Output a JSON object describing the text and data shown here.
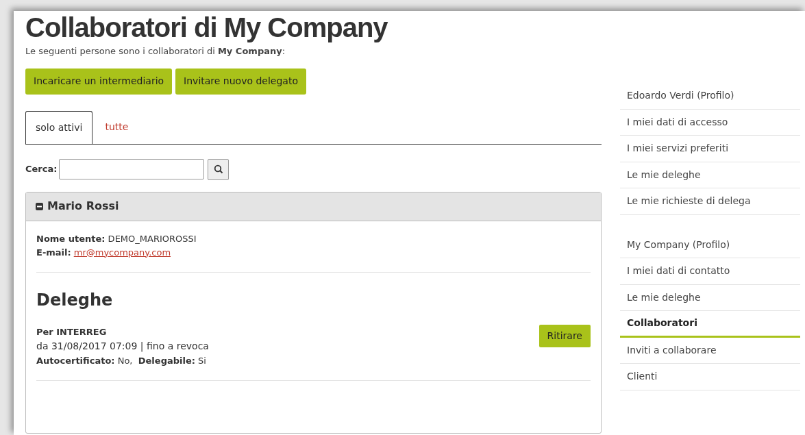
{
  "page": {
    "title": "Collaboratori di My Company",
    "subtitle": "Le seguenti persone sono i collaboratori di **My Company**:"
  },
  "actions": [
    "Incaricare un intermediario",
    "Invitare nuovo delegato"
  ],
  "tabs": [
    {
      "label": "solo attivi",
      "selected": true
    },
    {
      "label": "tutte",
      "selected": false
    }
  ],
  "search": {
    "label": "Cerca:"
  },
  "collaborator": {
    "name": "Mario Rossi",
    "expanded": true,
    "username": "**Nome utente:** DEMO_MARIOROSSI",
    "email_label": "E-mail:",
    "email": "mr@mycompany.com",
    "section_title": "Deleghe",
    "delegations": [
      {
        "title": "Per INTERREG",
        "period": "da 31/08/2017 07:09 | fino a revoca",
        "flags": "**Autocertificato:** No,  **Delegabile:** Si",
        "button": "Ritirare"
      }
    ]
  },
  "sidebar": {
    "groups": [
      {
        "items": [
          {
            "label": "Edoardo Verdi (Profilo)",
            "selected": false
          },
          {
            "label": "I miei dati di accesso",
            "selected": false
          },
          {
            "label": "I miei servizi preferiti",
            "selected": false
          },
          {
            "label": "Le mie deleghe",
            "selected": false
          },
          {
            "label": "Le mie richieste di delega",
            "selected": false
          }
        ]
      },
      {
        "items": [
          {
            "label": "My Company (Profilo)",
            "selected": false
          },
          {
            "label": "I miei dati di contatto",
            "selected": false
          },
          {
            "label": "Le mie deleghe",
            "selected": false
          },
          {
            "label": "Collaboratori",
            "selected": true
          },
          {
            "label": "Inviti a collaborare",
            "selected": false
          },
          {
            "label": "Clienti",
            "selected": false
          }
        ]
      }
    ]
  }
}
